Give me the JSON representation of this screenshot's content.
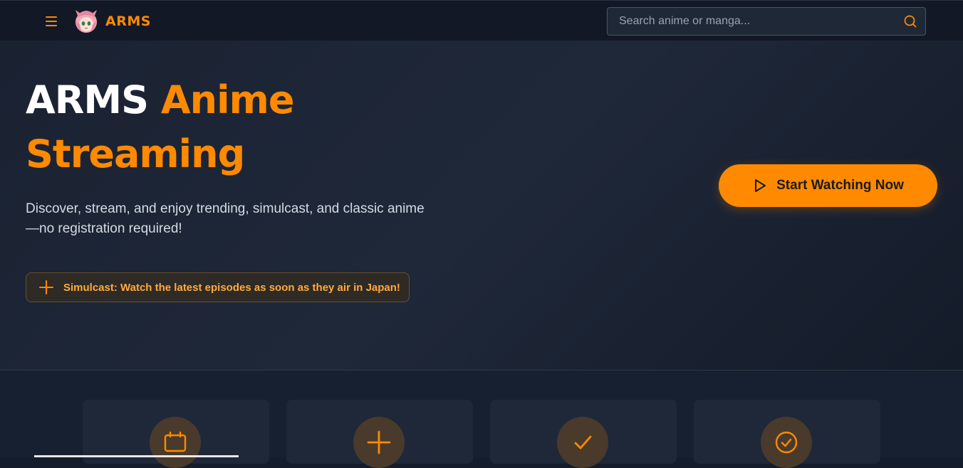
{
  "header": {
    "menu_icon": "hamburger-menu-icon",
    "brand": "ARMS",
    "search": {
      "placeholder": "Search anime or manga...",
      "value": ""
    }
  },
  "hero": {
    "title_white": "ARMS",
    "title_orange": "Anime Streaming",
    "description": "Discover, stream, and enjoy trending, simulcast, and classic anime—no registration required!",
    "simulcast_notice": "Simulcast: Watch the latest episodes as soon as they air in Japan!",
    "cta_label": "Start Watching Now"
  },
  "features": {
    "icons": [
      "calendar-icon",
      "plus-icon",
      "check-icon",
      "check-circle-icon"
    ]
  },
  "colors": {
    "accent": "#ff8a00",
    "background": "#151c2b",
    "header": "#121826"
  }
}
